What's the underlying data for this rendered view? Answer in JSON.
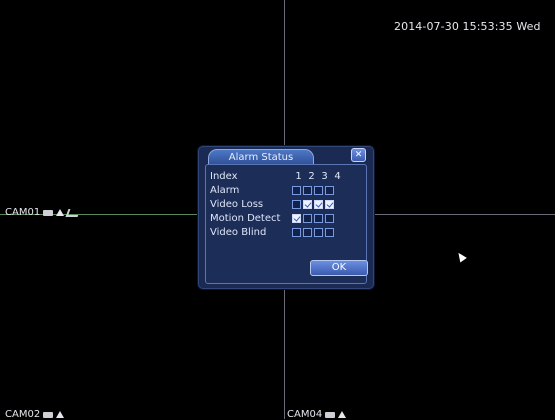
{
  "datetime": "2014-07-30 15:53:35 Wed",
  "cameras": [
    {
      "label": "CAM01"
    },
    {
      "label": "CAM02"
    },
    {
      "label": "CAM04"
    }
  ],
  "dialog": {
    "title": "Alarm Status",
    "close_glyph": "✕",
    "columns": [
      "1",
      "2",
      "3",
      "4"
    ],
    "rows": [
      {
        "label": "Index"
      },
      {
        "label": "Alarm",
        "states": [
          false,
          false,
          false,
          false
        ]
      },
      {
        "label": "Video Loss",
        "states": [
          false,
          true,
          true,
          true
        ]
      },
      {
        "label": "Motion Detect",
        "states": [
          true,
          false,
          false,
          false
        ]
      },
      {
        "label": "Video Blind",
        "states": [
          false,
          false,
          false,
          false
        ]
      }
    ],
    "ok_label": "OK"
  },
  "colors": {
    "dialog_bg": "#1a2a52",
    "accent": "#3a5cb0"
  }
}
